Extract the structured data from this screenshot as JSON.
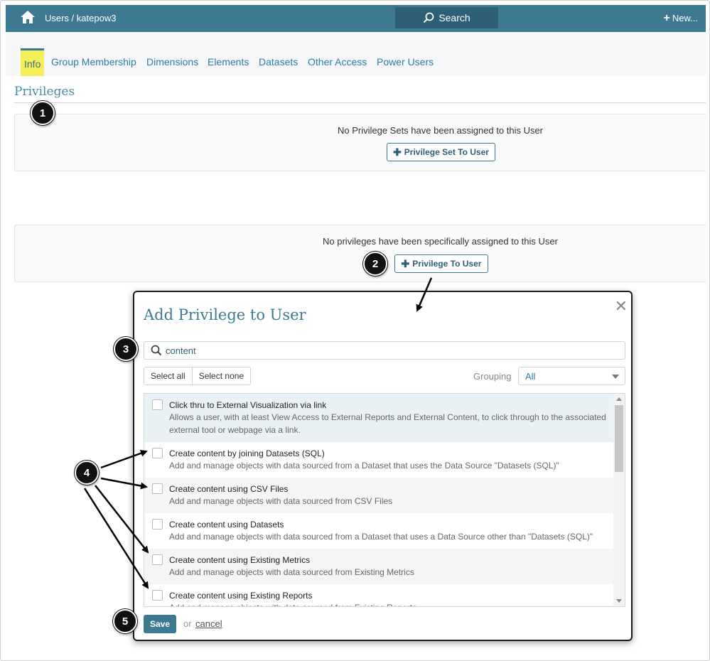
{
  "header": {
    "breadcrumb": "Users / katepow3",
    "search_label": "Search",
    "new_label": "New..."
  },
  "tabs": [
    {
      "label": "Info",
      "active": true
    },
    {
      "label": "Group Membership"
    },
    {
      "label": "Dimensions"
    },
    {
      "label": "Elements"
    },
    {
      "label": "Datasets"
    },
    {
      "label": "Other Access"
    },
    {
      "label": "Power Users"
    }
  ],
  "privileges": {
    "title": "Privileges",
    "sets_empty_msg": "No Privilege Sets have been assigned to this User",
    "add_set_label": "Privilege Set To User",
    "priv_empty_msg": "No privileges have been specifically assigned to this User",
    "add_priv_label": "Privilege To User"
  },
  "dialog": {
    "title": "Add Privilege to User",
    "search_value": "content",
    "select_all": "Select all",
    "select_none": "Select none",
    "grouping_label": "Grouping",
    "grouping_value": "All",
    "items": [
      {
        "name": "Click thru to External Visualization via link",
        "desc": "Allows a user, with at least View Access to External Reports and External Content, to click through to the associated external tool or webpage via a link."
      },
      {
        "name": "Create content by joining Datasets (SQL)",
        "desc": "Add and manage objects with data sourced from a Dataset that uses the Data Source \"Datasets (SQL)\""
      },
      {
        "name": "Create content using CSV Files",
        "desc": "Add and manage objects with data sourced from CSV Files"
      },
      {
        "name": "Create content using Datasets",
        "desc": "Add and manage objects with data sourced from a Dataset that uses a Data Source other than \"Datasets (SQL)\""
      },
      {
        "name": "Create content using Existing Metrics",
        "desc": "Add and manage objects with data sourced from Existing Metrics"
      },
      {
        "name": "Create content using Existing Reports",
        "desc": "Add and manage objects with data sourced from Existing Reports"
      }
    ],
    "save_label": "Save",
    "or_text": "or",
    "cancel_label": "cancel"
  },
  "annotations": [
    "1",
    "2",
    "3",
    "4",
    "5"
  ],
  "colors": {
    "header": "#3d7a92",
    "tab_highlight": "#f4ee58",
    "link": "#2e7ba6"
  }
}
